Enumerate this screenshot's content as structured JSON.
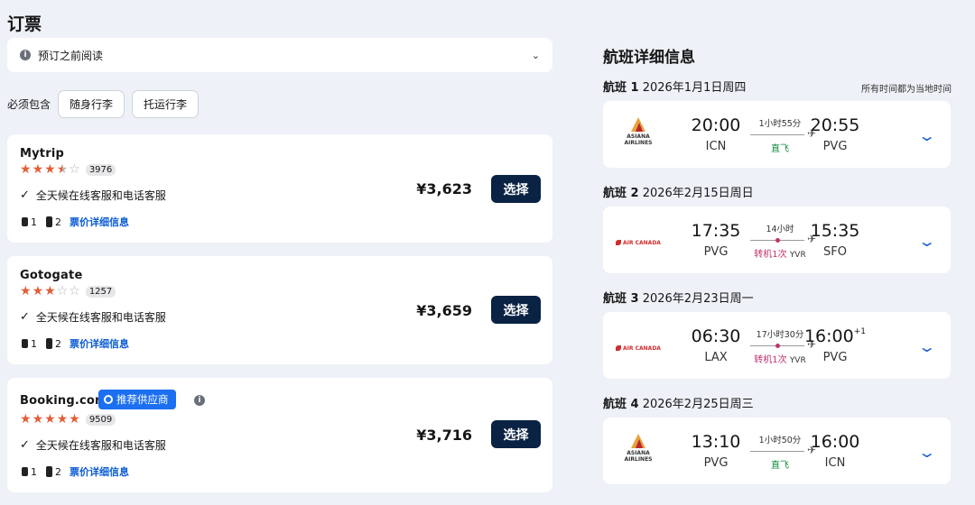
{
  "booking": {
    "title": "订票",
    "notice": "预订之前阅读",
    "must_include": "必须包含",
    "carry_on": "随身行李",
    "checked": "托运行李"
  },
  "offers": [
    {
      "name": "Mytrip",
      "rating": 3.5,
      "reviews": "3976",
      "feature": "全天候在线客服和电话客服",
      "bag1": "1",
      "bag2": "2",
      "link": "票价详细信息",
      "price": "¥3,623",
      "button": "选择"
    },
    {
      "name": "Gotogate",
      "rating": 3,
      "reviews": "1257",
      "feature": "全天候在线客服和电话客服",
      "bag1": "1",
      "bag2": "2",
      "link": "票价详细信息",
      "price": "¥3,659",
      "button": "选择"
    },
    {
      "name": "Booking.com",
      "badge": "推荐供应商",
      "rating": 5,
      "reviews": "9509",
      "feature": "全天候在线客服和电话客服",
      "bag1": "1",
      "bag2": "2",
      "link": "票价详细信息",
      "price": "¥3,716",
      "button": "选择"
    }
  ],
  "details": {
    "title": "航班详细信息",
    "local_note": "所有时间都为当地时间",
    "flights": [
      {
        "label": "航班 1",
        "date": "2026年1月1日周四",
        "airline": "ASIANA AIRLINES",
        "dep": "20:00",
        "dep_code": "ICN",
        "duration": "1小时55分",
        "stop": "直飞",
        "via": "",
        "arr": "20:55",
        "arr_suffix": "",
        "arr_code": "PVG"
      },
      {
        "label": "航班 2",
        "date": "2026年2月15日周日",
        "airline": "AIR CANADA",
        "dep": "17:35",
        "dep_code": "PVG",
        "duration": "14小时",
        "stop": "转机1次",
        "via": "YVR",
        "arr": "15:35",
        "arr_suffix": "",
        "arr_code": "SFO"
      },
      {
        "label": "航班 3",
        "date": "2026年2月23日周一",
        "airline": "AIR CANADA",
        "dep": "06:30",
        "dep_code": "LAX",
        "duration": "17小时30分",
        "stop": "转机1次",
        "via": "YVR",
        "arr": "16:00",
        "arr_suffix": "+1",
        "arr_code": "PVG"
      },
      {
        "label": "航班 4",
        "date": "2026年2月25日周三",
        "airline": "ASIANA AIRLINES",
        "dep": "13:10",
        "dep_code": "PVG",
        "duration": "1小时50分",
        "stop": "直飞",
        "via": "",
        "arr": "16:00",
        "arr_suffix": "",
        "arr_code": "ICN"
      }
    ]
  },
  "colors": {
    "accent": "#0a5bd3",
    "button": "#0a2243",
    "star": "#e35d37",
    "direct": "#0e8a3e",
    "transfer": "#c0326f"
  }
}
